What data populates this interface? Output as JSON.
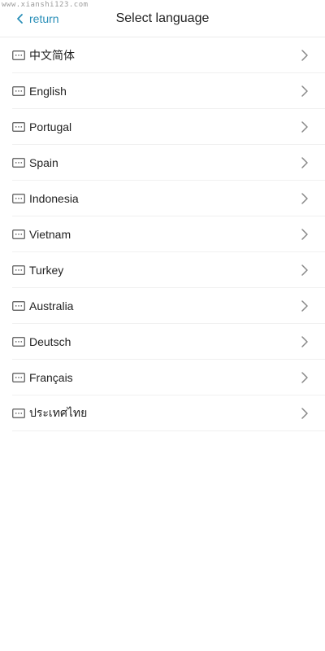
{
  "watermark": "www.xianshi123.com",
  "header": {
    "back_label": "return",
    "title": "Select language",
    "accent_color": "#2a8fb8"
  },
  "languages": [
    {
      "label": "中文简体"
    },
    {
      "label": "English"
    },
    {
      "label": "Portugal"
    },
    {
      "label": "Spain"
    },
    {
      "label": "Indonesia"
    },
    {
      "label": "Vietnam"
    },
    {
      "label": "Turkey"
    },
    {
      "label": "Australia"
    },
    {
      "label": "Deutsch"
    },
    {
      "label": "Français"
    },
    {
      "label": "ประเทศไทย"
    }
  ],
  "icons": {
    "back": "chevron-left-icon",
    "item": "keyboard-icon",
    "item_action": "chevron-right-icon"
  }
}
